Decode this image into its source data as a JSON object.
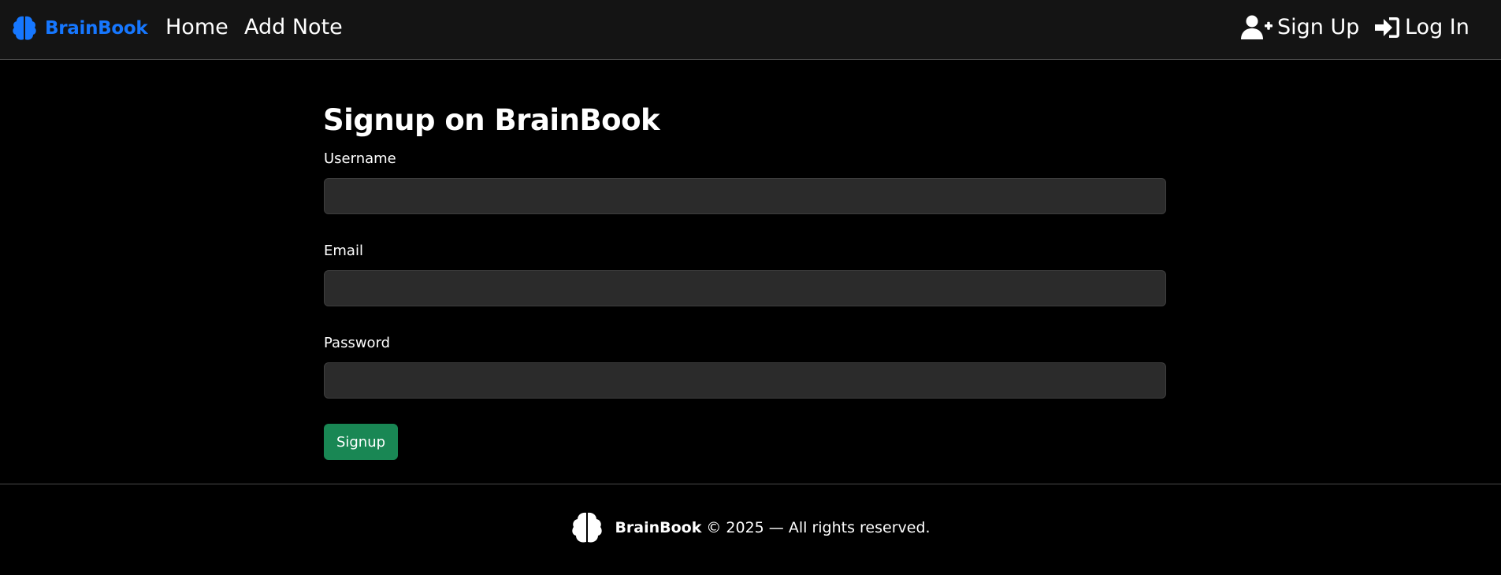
{
  "navbar": {
    "brand": {
      "label": "BrainBook",
      "icon": "brain-icon",
      "color": "#1677ff"
    },
    "links": {
      "home": "Home",
      "add_note": "Add Note"
    },
    "auth": {
      "signup": {
        "label": "Sign Up",
        "icon": "user-plus-icon"
      },
      "login": {
        "label": "Log In",
        "icon": "sign-in-icon"
      }
    }
  },
  "form": {
    "title": "Signup on BrainBook",
    "fields": {
      "username": {
        "label": "Username",
        "value": "",
        "placeholder": ""
      },
      "email": {
        "label": "Email",
        "value": "",
        "placeholder": ""
      },
      "password": {
        "label": "Password",
        "value": "",
        "placeholder": ""
      }
    },
    "submit": {
      "label": "Signup",
      "color": "#198754"
    }
  },
  "footer": {
    "icon": "brain-icon",
    "brand": "BrainBook",
    "text": "© 2025 — All rights reserved."
  },
  "theme": {
    "background": "#000000",
    "navbar_background": "#141414",
    "input_background": "#2b2b2b"
  }
}
